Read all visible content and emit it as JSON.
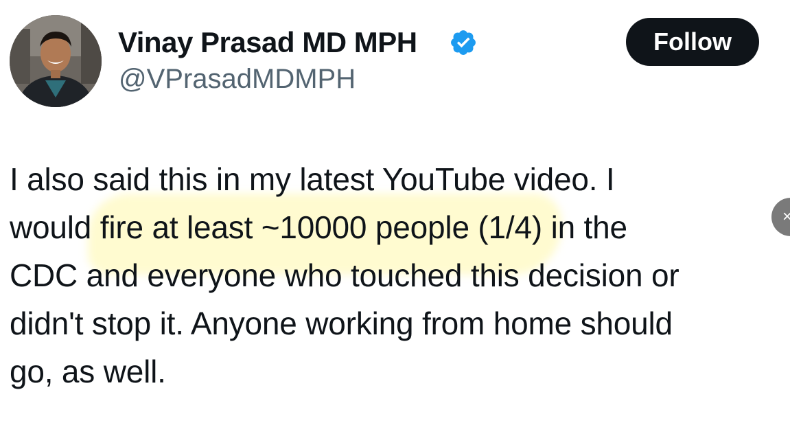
{
  "author": {
    "display_name": "Vinay Prasad MD MPH",
    "handle": "@VPrasadMDMPH",
    "verified": true,
    "avatar_icon": "profile-photo",
    "verified_icon": "verified-badge-icon",
    "verified_color": "#1d9bf0"
  },
  "actions": {
    "follow_label": "Follow"
  },
  "tweet": {
    "lines": [
      "I also said this in my latest YouTube video. I",
      "would fire at least ~10000 people (1/4) in the",
      "CDC and everyone who touched this decision or",
      "didn't stop it.  Anyone working from home should",
      "go, as well."
    ],
    "highlight_color": "#fff8aa"
  },
  "nav": {
    "next_icon": "close-icon",
    "next_glyph": "×"
  }
}
